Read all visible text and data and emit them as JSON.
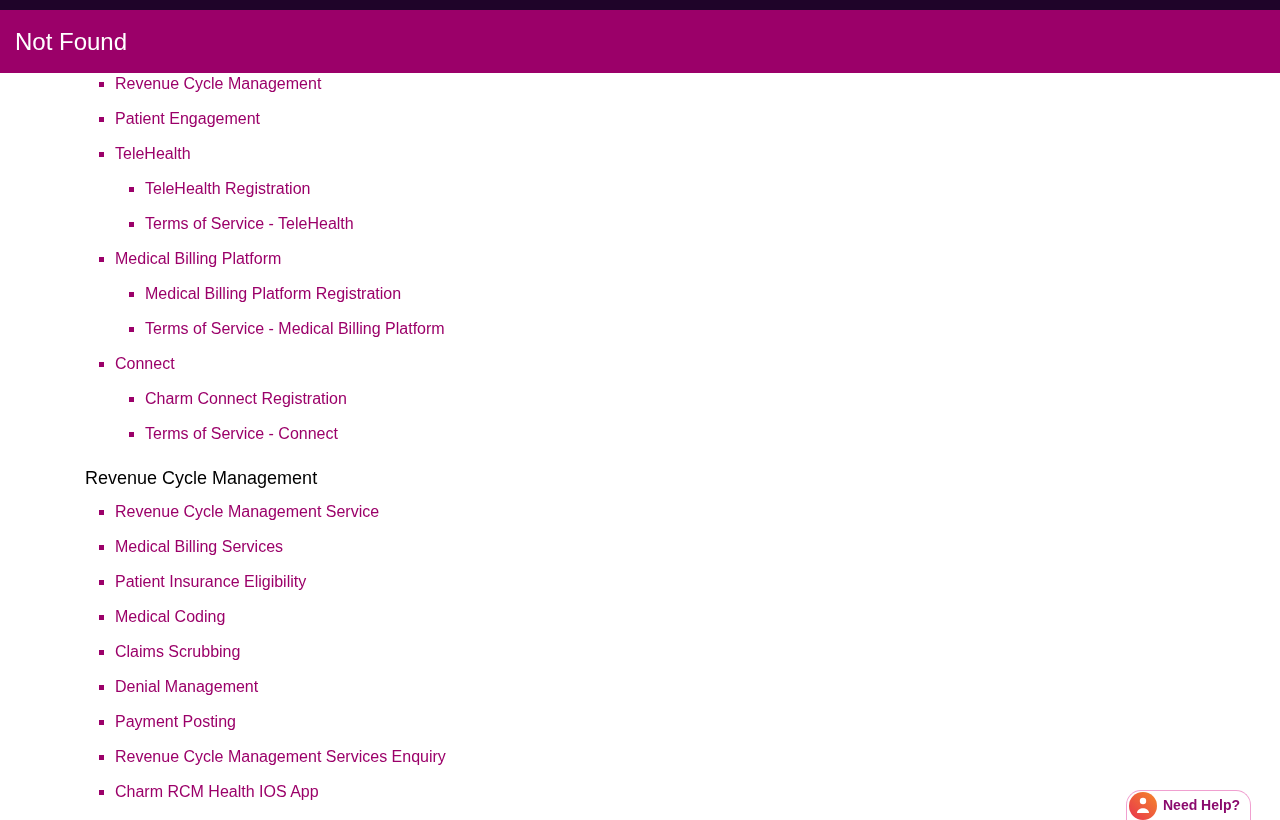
{
  "header": {
    "title": "Not Found"
  },
  "sections": [
    {
      "items": [
        {
          "label": "Revenue Cycle Management"
        },
        {
          "label": "Patient Engagement"
        },
        {
          "label": "TeleHealth",
          "children": [
            {
              "label": "TeleHealth Registration"
            },
            {
              "label": "Terms of Service - TeleHealth"
            }
          ]
        },
        {
          "label": "Medical Billing Platform",
          "children": [
            {
              "label": "Medical Billing Platform Registration"
            },
            {
              "label": "Terms of Service - Medical Billing Platform"
            }
          ]
        },
        {
          "label": "Connect",
          "children": [
            {
              "label": "Charm Connect Registration"
            },
            {
              "label": "Terms of Service - Connect"
            }
          ]
        }
      ]
    },
    {
      "heading": "Revenue Cycle Management",
      "items": [
        {
          "label": "Revenue Cycle Management Service"
        },
        {
          "label": "Medical Billing Services"
        },
        {
          "label": "Patient Insurance Eligibility"
        },
        {
          "label": "Medical Coding"
        },
        {
          "label": "Claims Scrubbing"
        },
        {
          "label": "Denial Management"
        },
        {
          "label": "Payment Posting"
        },
        {
          "label": "Revenue Cycle Management Services Enquiry"
        },
        {
          "label": "Charm RCM Health IOS App"
        }
      ]
    }
  ],
  "help_button": {
    "label": "Need Help?"
  }
}
